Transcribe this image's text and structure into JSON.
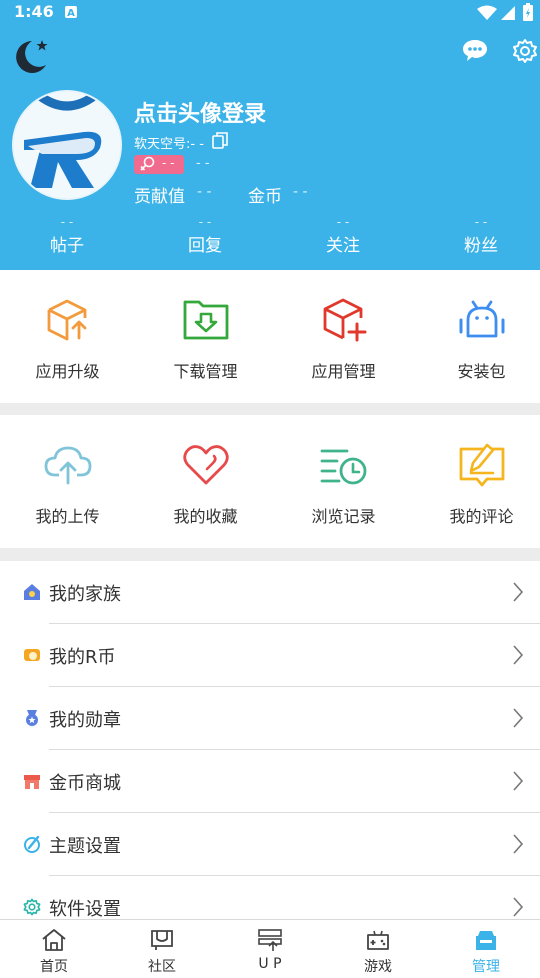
{
  "status_bar": {
    "time": "1:46"
  },
  "profile": {
    "login_prompt": "点击头像登录",
    "account_label": "软天空号:- -",
    "gender_level": "- -",
    "level_value": "- -",
    "contribution_label": "贡献值",
    "contribution_value": "- -",
    "coins_label": "金币",
    "coins_value": "- -"
  },
  "stats": [
    {
      "label": "帖子",
      "value": "- -"
    },
    {
      "label": "回复",
      "value": "- -"
    },
    {
      "label": "关注",
      "value": "- -"
    },
    {
      "label": "粉丝",
      "value": "- -"
    }
  ],
  "grid1": [
    {
      "label": "应用升级",
      "icon": "app-upgrade-icon",
      "color": "#f39a3c"
    },
    {
      "label": "下载管理",
      "icon": "download-manage-icon",
      "color": "#35a83c"
    },
    {
      "label": "应用管理",
      "icon": "app-manage-icon",
      "color": "#e0392b"
    },
    {
      "label": "安装包",
      "icon": "android-package-icon",
      "color": "#3d8ef0"
    }
  ],
  "grid2": [
    {
      "label": "我的上传",
      "icon": "upload-cloud-icon",
      "color": "#7fc4d9"
    },
    {
      "label": "我的收藏",
      "icon": "favorite-heart-icon",
      "color": "#e64a4a"
    },
    {
      "label": "浏览记录",
      "icon": "history-clock-icon",
      "color": "#3fb38a"
    },
    {
      "label": "我的评论",
      "icon": "comment-edit-icon",
      "color": "#f5b51f"
    }
  ],
  "menu": [
    {
      "label": "我的家族",
      "icon": "family-icon"
    },
    {
      "label": "我的R币",
      "icon": "r-coin-icon"
    },
    {
      "label": "我的勋章",
      "icon": "medal-icon"
    },
    {
      "label": "金币商城",
      "icon": "coin-mall-icon"
    },
    {
      "label": "主题设置",
      "icon": "theme-icon"
    },
    {
      "label": "软件设置",
      "icon": "software-settings-icon"
    }
  ],
  "bottom_nav": [
    {
      "label": "首页",
      "icon": "home-icon"
    },
    {
      "label": "社区",
      "icon": "community-icon"
    },
    {
      "label": "U P",
      "icon": "up-icon"
    },
    {
      "label": "游戏",
      "icon": "gamepad-icon"
    },
    {
      "label": "管理",
      "icon": "manage-icon",
      "active": true
    }
  ],
  "colors": {
    "primary": "#3cb3e8",
    "badge": "#f06b8e"
  }
}
